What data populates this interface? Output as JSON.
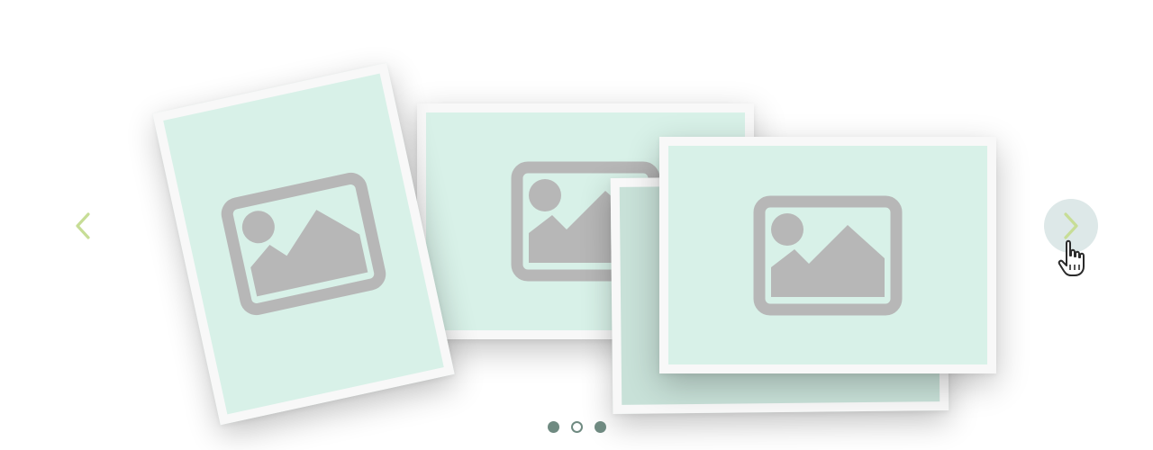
{
  "colors": {
    "background": "#ffffff",
    "card_border": "#f8f8f8",
    "card_fill": "#d8f1e8",
    "card_fill_shaded": "#c8e1d8",
    "placeholder_icon": "#b7b7b7",
    "arrow": "#c7dd96",
    "next_hover_bg": "#dde8e8",
    "dot": "#6f8a81"
  },
  "carousel": {
    "slides": [
      {
        "name": "slide-portrait-tilted",
        "icon": "image-placeholder-icon"
      },
      {
        "name": "slide-landscape-back",
        "icon": "image-placeholder-icon"
      },
      {
        "name": "slide-landscape-middle",
        "icon": "image-placeholder-icon"
      },
      {
        "name": "slide-landscape-front",
        "icon": "image-placeholder-icon"
      }
    ],
    "prev_icon": "chevron-left-icon",
    "next_icon": "chevron-right-icon",
    "cursor_icon": "hand-pointer-icon",
    "pagination": {
      "total": 3,
      "active_index": 1
    }
  }
}
